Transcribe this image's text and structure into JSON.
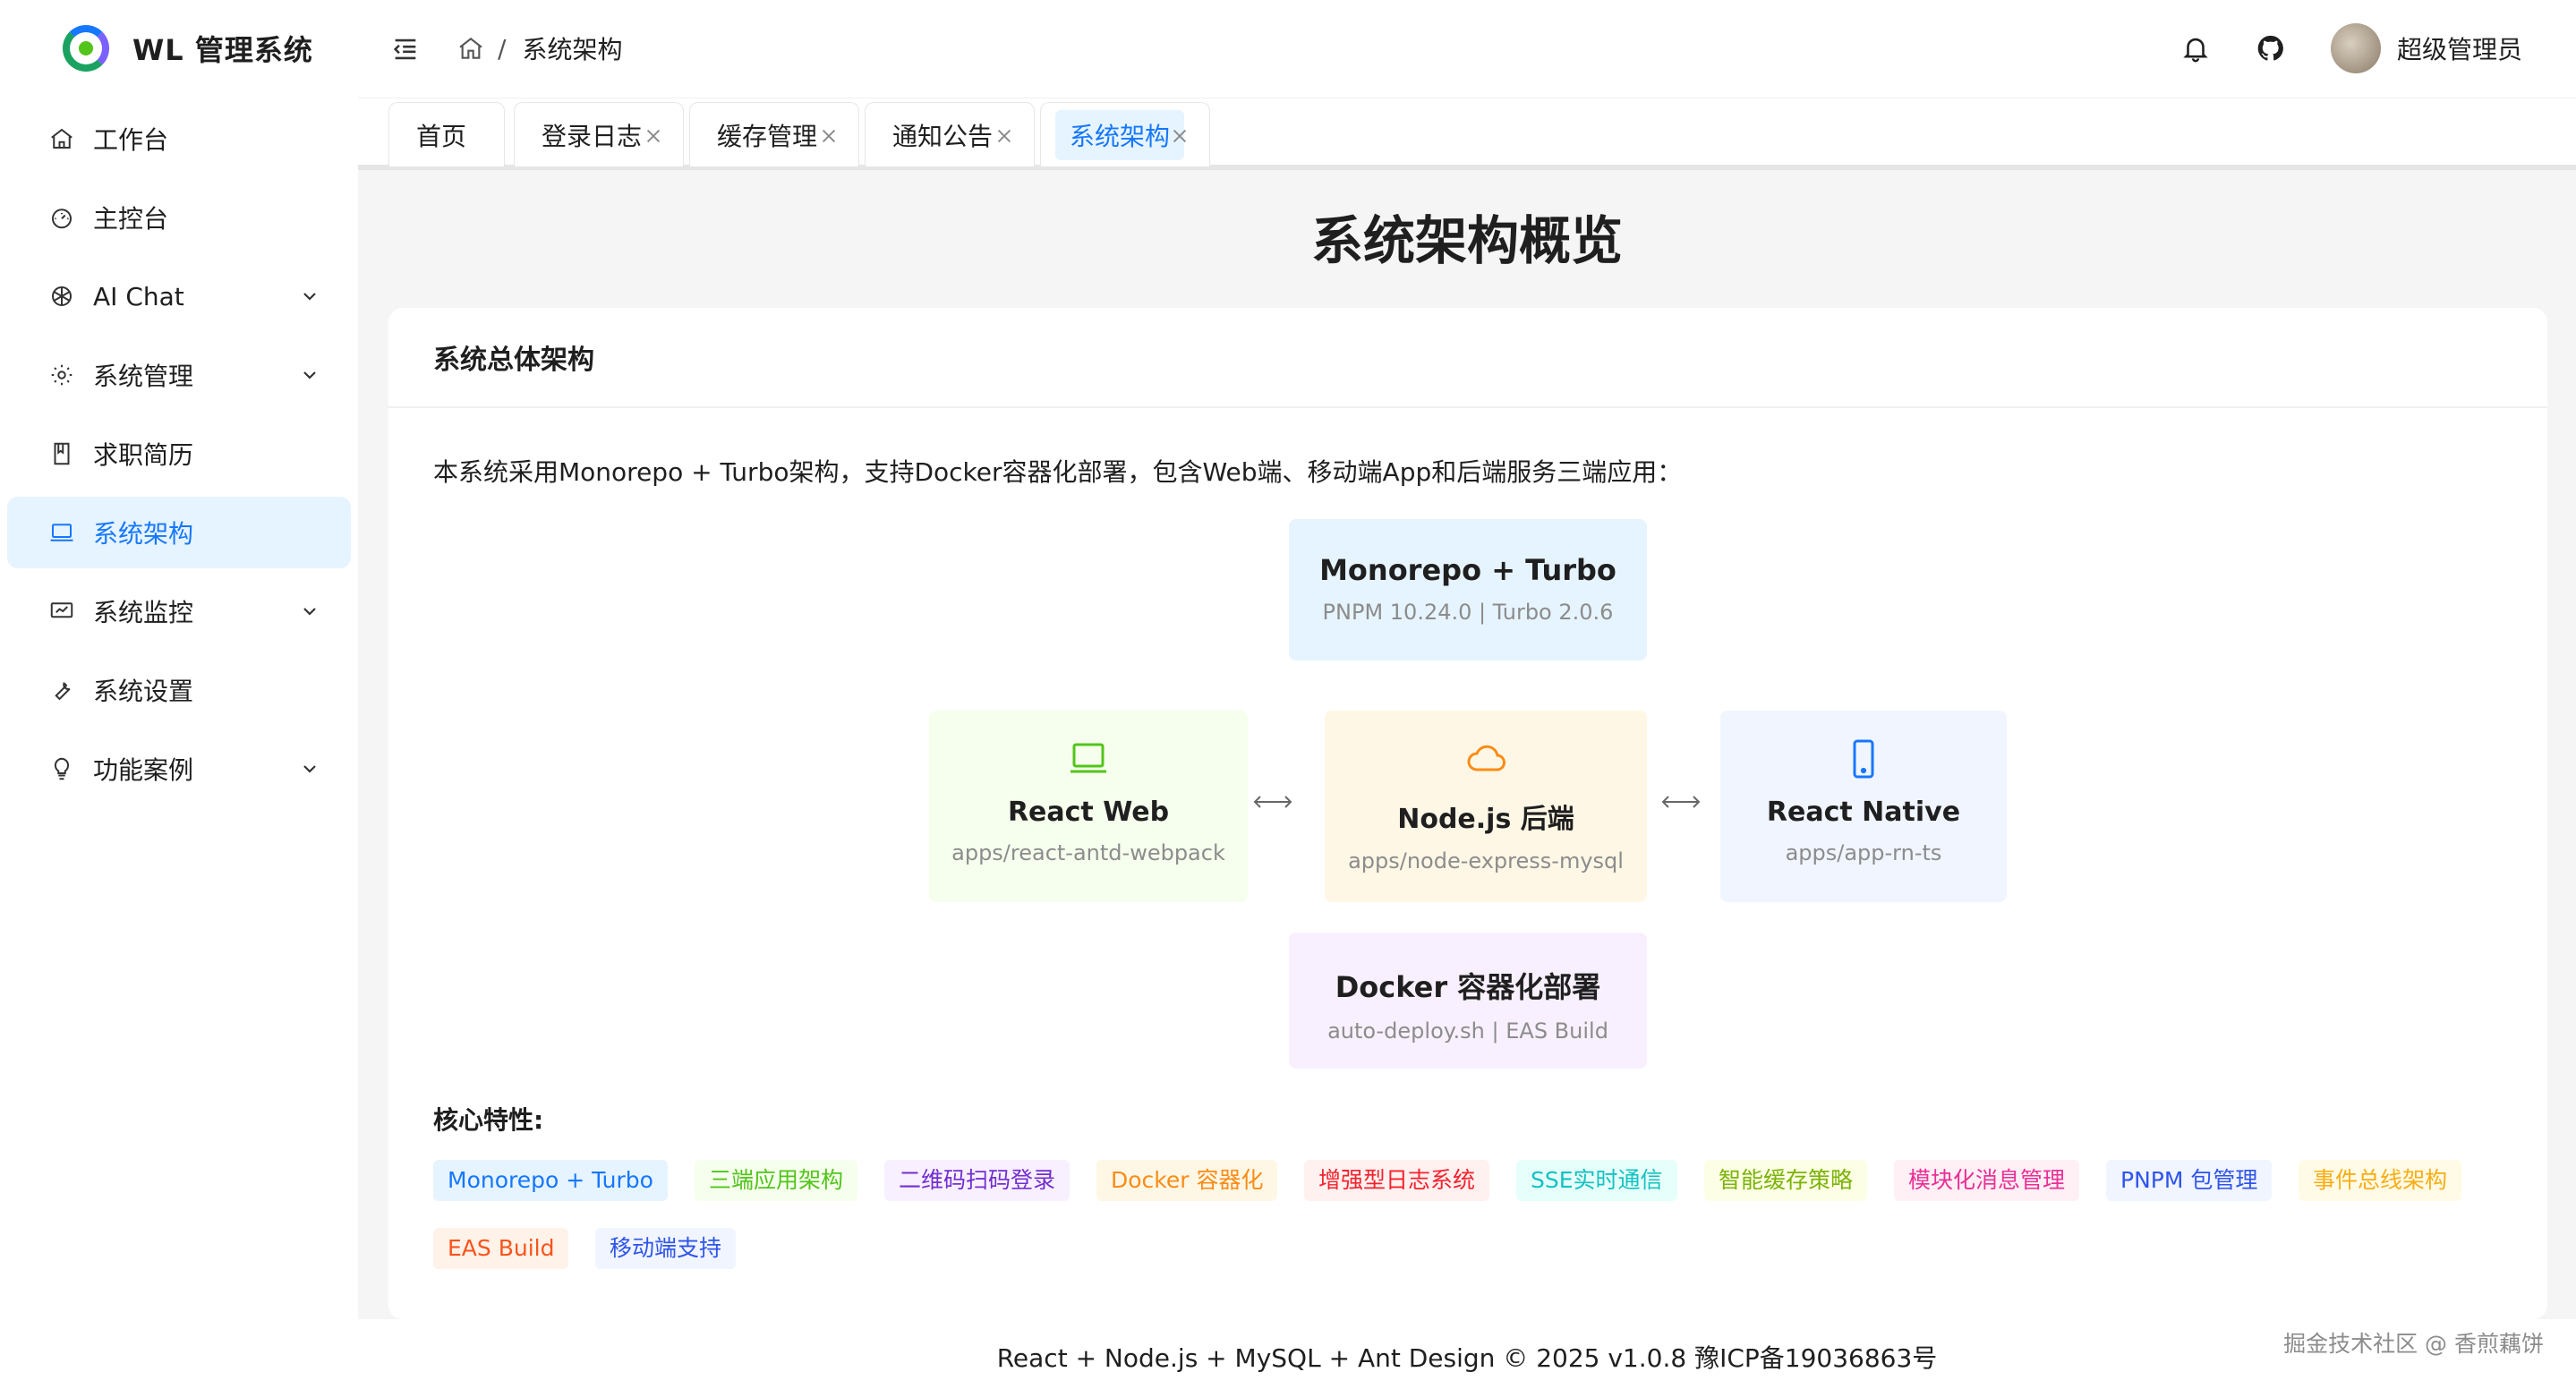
{
  "app": {
    "title": "WL 管理系统"
  },
  "sidebar": {
    "items": [
      {
        "label": "工作台",
        "icon": "home-icon",
        "expandable": false,
        "active": false
      },
      {
        "label": "主控台",
        "icon": "dashboard-icon",
        "expandable": false,
        "active": false
      },
      {
        "label": "AI Chat",
        "icon": "openai-icon",
        "expandable": true,
        "active": false
      },
      {
        "label": "系统管理",
        "icon": "gear-icon",
        "expandable": true,
        "active": false
      },
      {
        "label": "求职简历",
        "icon": "book-icon",
        "expandable": false,
        "active": false
      },
      {
        "label": "系统架构",
        "icon": "laptop-icon",
        "expandable": false,
        "active": true
      },
      {
        "label": "系统监控",
        "icon": "monitor-icon",
        "expandable": true,
        "active": false
      },
      {
        "label": "系统设置",
        "icon": "wrench-icon",
        "expandable": false,
        "active": false
      },
      {
        "label": "功能案例",
        "icon": "bulb-icon",
        "expandable": true,
        "active": false
      }
    ]
  },
  "header": {
    "breadcrumb": {
      "separator": "/",
      "current": "系统架构"
    },
    "user_name": "超级管理员"
  },
  "tabs": [
    {
      "label": "首页",
      "closable": false,
      "active": false
    },
    {
      "label": "登录日志",
      "closable": true,
      "active": false
    },
    {
      "label": "缓存管理",
      "closable": true,
      "active": false
    },
    {
      "label": "通知公告",
      "closable": true,
      "active": false
    },
    {
      "label": "系统架构",
      "closable": true,
      "active": true
    }
  ],
  "main": {
    "page_title": "系统架构概览",
    "card_title": "系统总体架构",
    "intro": "本系统采用Monorepo + Turbo架构，支持Docker容器化部署，包含Web端、移动端App和后端服务三端应用：",
    "diagram": {
      "monorepo": {
        "title": "Monorepo + Turbo",
        "sub": "PNPM 10.24.0 | Turbo 2.0.6"
      },
      "web": {
        "title": "React Web",
        "sub": "apps/react-antd-webpack",
        "icon": "laptop-icon"
      },
      "node": {
        "title": "Node.js 后端",
        "sub": "apps/node-express-mysql",
        "icon": "cloud-icon"
      },
      "rn": {
        "title": "React Native",
        "sub": "apps/app-rn-ts",
        "icon": "mobile-icon"
      },
      "docker": {
        "title": "Docker 容器化部署",
        "sub": "auto-deploy.sh | EAS Build"
      },
      "arrow": "⟷"
    },
    "features_label": "核心特性:",
    "features": [
      {
        "label": "Monorepo + Turbo",
        "color": "#1677ff",
        "bg": "#e6f4ff"
      },
      {
        "label": "三端应用架构",
        "color": "#52c41a",
        "bg": "#f6ffed"
      },
      {
        "label": "二维码扫码登录",
        "color": "#722ed1",
        "bg": "#f9f0ff"
      },
      {
        "label": "Docker 容器化",
        "color": "#fa8c16",
        "bg": "#fff7e6"
      },
      {
        "label": "增强型日志系统",
        "color": "#f5222d",
        "bg": "#fff1f0"
      },
      {
        "label": "SSE实时通信",
        "color": "#13c2c2",
        "bg": "#e6fffb"
      },
      {
        "label": "智能缓存策略",
        "color": "#7cb305",
        "bg": "#fcffe6"
      },
      {
        "label": "模块化消息管理",
        "color": "#eb2f96",
        "bg": "#fff0f6"
      },
      {
        "label": "PNPM 包管理",
        "color": "#2f54eb",
        "bg": "#f0f5ff"
      },
      {
        "label": "事件总线架构",
        "color": "#faad14",
        "bg": "#fffbe6"
      },
      {
        "label": "EAS Build",
        "color": "#fa541c",
        "bg": "#fff2e8"
      },
      {
        "label": "移动端支持",
        "color": "#2f54eb",
        "bg": "#f0f5ff"
      }
    ]
  },
  "footer": {
    "text": "React + Node.js + MySQL + Ant Design © 2025 v1.0.8   豫ICP备19036863号"
  },
  "watermark": "掘金技术社区 @ 香煎藕饼",
  "colors": {
    "accent": "#1677ff",
    "active_bg": "#e6f4ff"
  }
}
